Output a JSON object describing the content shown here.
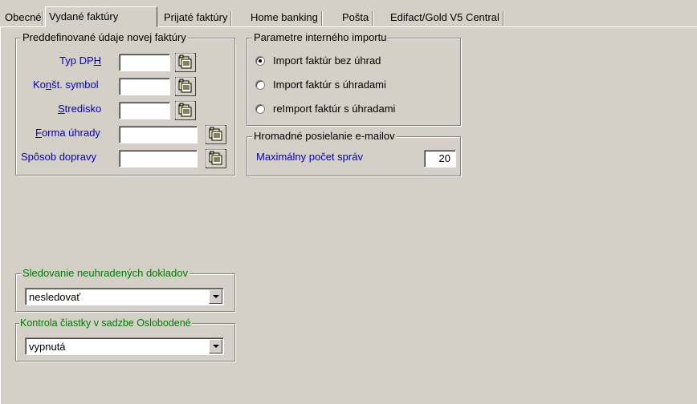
{
  "tabs": [
    {
      "label": "Obecné",
      "active": false
    },
    {
      "label": "Vydané faktúry",
      "active": true
    },
    {
      "label": "Prijaté faktúry",
      "active": false
    },
    {
      "label": "Home banking",
      "active": false
    },
    {
      "label": "Pošta",
      "active": false
    },
    {
      "label": "Edifact/Gold V5 Central",
      "active": false
    }
  ],
  "invoice_defaults": {
    "title": "Preddefinované údaje novej faktúry",
    "fields": [
      {
        "label_pre": "Typ DP",
        "label_ul": "H",
        "label_post": "",
        "value": "",
        "icon": "lookup-icon"
      },
      {
        "label_pre": "Ko",
        "label_ul": "n",
        "label_post": "št. symbol",
        "value": "",
        "icon": "lookup-icon"
      },
      {
        "label_pre": "",
        "label_ul": "S",
        "label_post": "tredisko",
        "value": "",
        "icon": "lookup-icon"
      },
      {
        "label_pre": "",
        "label_ul": "F",
        "label_post": "orma úhrady",
        "value": "",
        "icon": "lookup-icon"
      },
      {
        "label_pre": "Spôsob dopravy",
        "label_ul": "",
        "label_post": "",
        "value": "",
        "icon": "lookup-icon"
      }
    ]
  },
  "internal_import": {
    "title": "Parametre interného importu",
    "options": [
      {
        "label": "Import faktúr bez úhrad",
        "checked": true
      },
      {
        "label": "Import faktúr s úhradami",
        "checked": false
      },
      {
        "label": "reImport faktúr s úhradami",
        "checked": false
      }
    ]
  },
  "bulk_email": {
    "title": "Hromadné posielanie e-mailov",
    "max_label": "Maximálny počet správ",
    "max_value": "20"
  },
  "unpaid_tracking": {
    "title": "Sledovanie neuhradených dokladov",
    "selected": "nesledovať"
  },
  "exempt_check": {
    "title": "Kontrola čiastky v sadzbe Oslobodené",
    "selected": "vypnutá"
  },
  "colors": {
    "link_blue": "#0000c8",
    "group_green": "#007a00",
    "face": "#d4d0c8"
  }
}
